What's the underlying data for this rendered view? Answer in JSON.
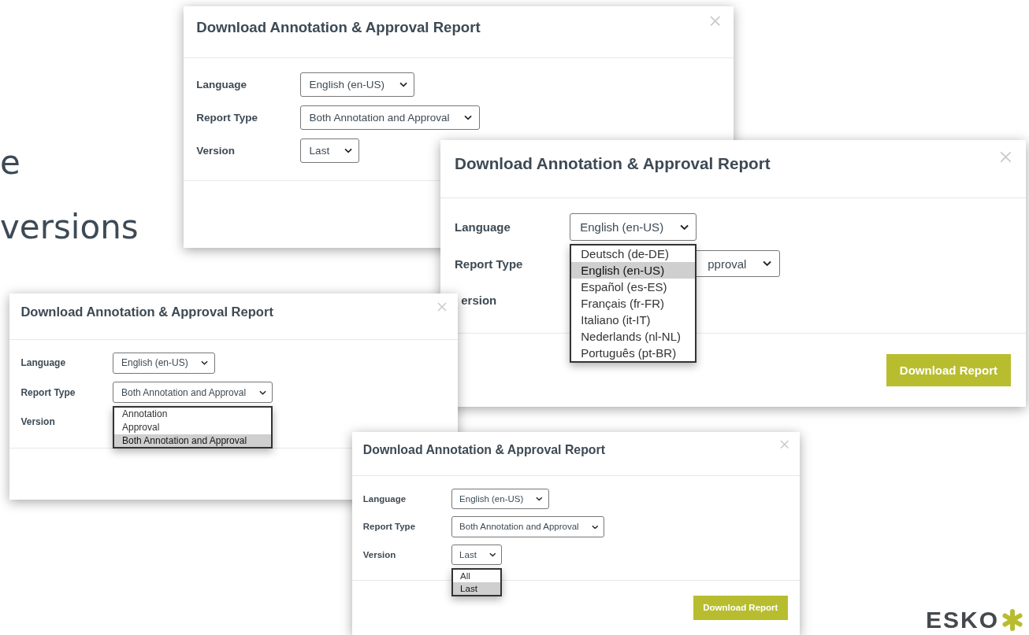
{
  "slide": {
    "text_fragments": [
      "e",
      "versions"
    ],
    "logo": "ESKO"
  },
  "dialogs": [
    {
      "title": "Download Annotation & Approval Report",
      "fields": [
        {
          "label": "Language",
          "value": "English (en-US)"
        },
        {
          "label": "Report Type",
          "value": "Both Annotation and Approval"
        },
        {
          "label": "Version",
          "value": "Last"
        }
      ]
    },
    {
      "title": "Download Annotation & Approval Report",
      "fields": [
        {
          "label": "Language",
          "value": "English (en-US)",
          "options": [
            {
              "label": "Deutsch (de-DE)",
              "selected": false
            },
            {
              "label": "English (en-US)",
              "selected": true
            },
            {
              "label": "Español (es-ES)",
              "selected": false
            },
            {
              "label": "Français (fr-FR)",
              "selected": false
            },
            {
              "label": "Italiano (it-IT)",
              "selected": false
            },
            {
              "label": "Nederlands (nl-NL)",
              "selected": false
            },
            {
              "label": "Português (pt-BR)",
              "selected": false
            }
          ]
        },
        {
          "label": "Report Type",
          "value": "pproval"
        },
        {
          "label": "ersion"
        }
      ],
      "button": "Download Report"
    },
    {
      "title": "Download Annotation & Approval Report",
      "fields": [
        {
          "label": "Language",
          "value": "English (en-US)"
        },
        {
          "label": "Report Type",
          "value": "Both Annotation and Approval",
          "options": [
            {
              "label": "Annotation",
              "selected": false
            },
            {
              "label": "Approval",
              "selected": false
            },
            {
              "label": "Both Annotation and Approval",
              "selected": true
            }
          ]
        },
        {
          "label": "Version"
        }
      ]
    },
    {
      "title": "Download Annotation & Approval Report",
      "fields": [
        {
          "label": "Language",
          "value": "English (en-US)"
        },
        {
          "label": "Report Type",
          "value": "Both Annotation and Approval"
        },
        {
          "label": "Version",
          "value": "Last",
          "options": [
            {
              "label": "All",
              "selected": false
            },
            {
              "label": "Last",
              "selected": true
            }
          ]
        }
      ],
      "button": "Download Report"
    }
  ]
}
